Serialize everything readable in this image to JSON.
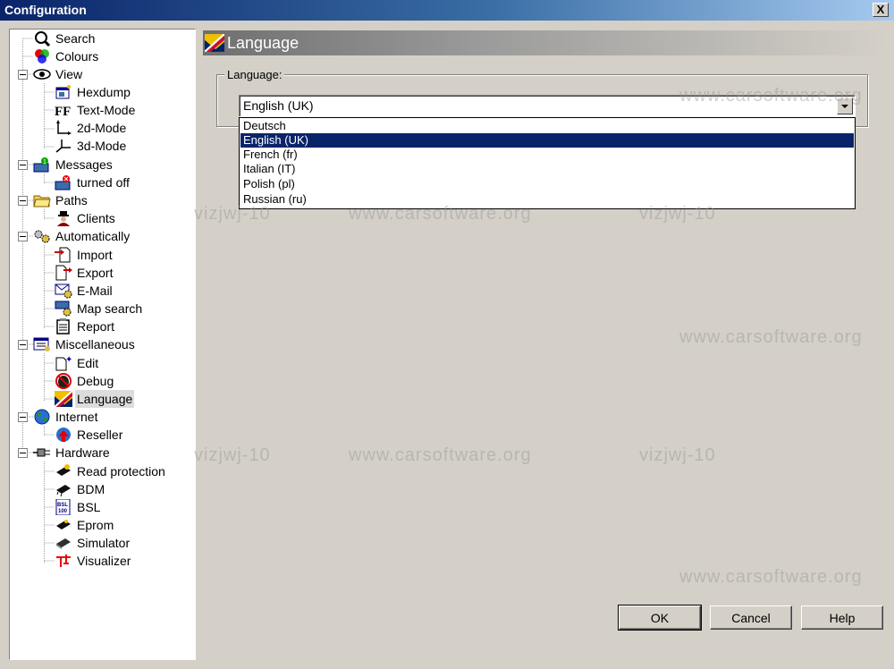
{
  "window": {
    "title": "Configuration",
    "close_label": "X"
  },
  "tree": [
    {
      "label": "Search",
      "icon": "search-icon",
      "level": 0
    },
    {
      "label": "Colours",
      "icon": "colours-icon",
      "level": 0
    },
    {
      "label": "View",
      "icon": "eye-icon",
      "level": 0,
      "expanded": true
    },
    {
      "label": "Hexdump",
      "icon": "hexdump-icon",
      "level": 1
    },
    {
      "label": "Text-Mode",
      "icon": "text-mode-icon",
      "level": 1
    },
    {
      "label": "2d-Mode",
      "icon": "2d-mode-icon",
      "level": 1
    },
    {
      "label": "3d-Mode",
      "icon": "3d-mode-icon",
      "level": 1
    },
    {
      "label": "Messages",
      "icon": "messages-icon",
      "level": 0,
      "expanded": true
    },
    {
      "label": "turned off",
      "icon": "turned-off-icon",
      "level": 1
    },
    {
      "label": "Paths",
      "icon": "folder-icon",
      "level": 0,
      "expanded": true
    },
    {
      "label": "Clients",
      "icon": "clients-icon",
      "level": 1
    },
    {
      "label": "Automatically",
      "icon": "gears-icon",
      "level": 0,
      "expanded": true
    },
    {
      "label": "Import",
      "icon": "import-icon",
      "level": 1
    },
    {
      "label": "Export",
      "icon": "export-icon",
      "level": 1
    },
    {
      "label": "E-Mail",
      "icon": "email-icon",
      "level": 1
    },
    {
      "label": "Map search",
      "icon": "map-search-icon",
      "level": 1
    },
    {
      "label": "Report",
      "icon": "report-icon",
      "level": 1
    },
    {
      "label": "Miscellaneous",
      "icon": "miscellaneous-icon",
      "level": 0,
      "expanded": true
    },
    {
      "label": "Edit",
      "icon": "edit-icon",
      "level": 1
    },
    {
      "label": "Debug",
      "icon": "debug-icon",
      "level": 1
    },
    {
      "label": "Language",
      "icon": "uk-flag-icon",
      "level": 1,
      "selected": true
    },
    {
      "label": "Internet",
      "icon": "globe-icon",
      "level": 0,
      "expanded": true
    },
    {
      "label": "Reseller",
      "icon": "reseller-icon",
      "level": 1
    },
    {
      "label": "Hardware",
      "icon": "plug-icon",
      "level": 0,
      "expanded": true
    },
    {
      "label": "Read protection",
      "icon": "chip-icon",
      "level": 1
    },
    {
      "label": "BDM",
      "icon": "bdm-chip-icon",
      "level": 1
    },
    {
      "label": "BSL",
      "icon": "bsl-icon",
      "level": 1
    },
    {
      "label": "Eprom",
      "icon": "eprom-icon",
      "level": 1
    },
    {
      "label": "Simulator",
      "icon": "simulator-icon",
      "level": 1
    },
    {
      "label": "Visualizer",
      "icon": "visualizer-icon",
      "level": 1
    }
  ],
  "panel": {
    "title": "Language",
    "group_label": "Language:",
    "combo_value": "English (UK)",
    "options": [
      "Deutsch",
      "English (UK)",
      "French (fr)",
      "Italian (IT)",
      "Polish (pl)",
      "Russian (ru)"
    ],
    "selected_option": "English (UK)"
  },
  "buttons": {
    "ok": "OK",
    "cancel": "Cancel",
    "help": "Help"
  },
  "watermarks": {
    "site": "www.carsoftware.org",
    "code": "vizjwj-10"
  },
  "colors": {
    "title_bar": "#0a246a",
    "selection": "#0a246a",
    "dialog_bg": "#d4d0c8"
  }
}
